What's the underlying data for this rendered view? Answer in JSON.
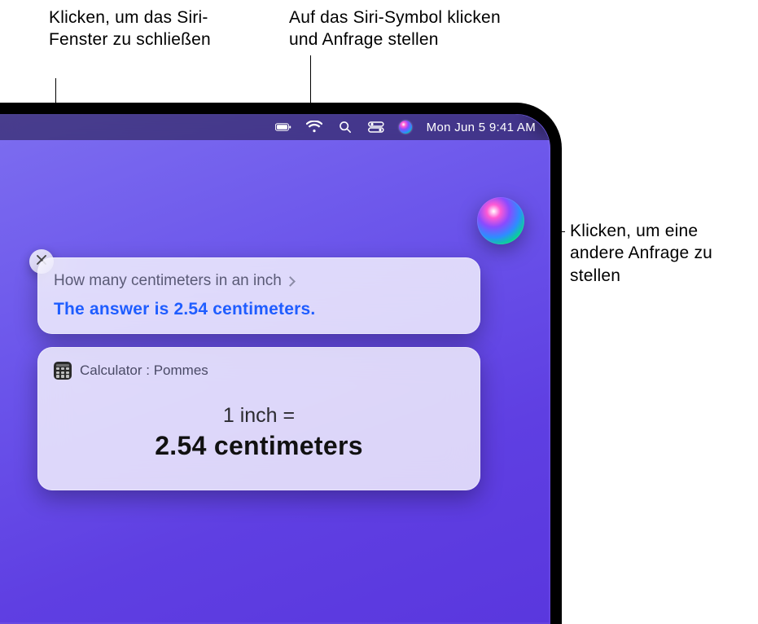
{
  "callouts": {
    "close": "Klicken, um das Siri-Fenster zu schließen",
    "siri_menu": "Auf das Siri-Symbol klicken und Anfrage stellen",
    "orb": "Klicken, um eine andere Anfrage zu stellen"
  },
  "menubar": {
    "datetime": "Mon Jun 5  9:41 AM",
    "icons": {
      "battery": "battery-icon",
      "wifi": "wifi-icon",
      "search": "search-icon",
      "control_center": "control-center-icon",
      "siri": "siri-icon"
    }
  },
  "siri": {
    "query": "How many centimeters in an inch",
    "answer": "The answer is 2.54 centimeters."
  },
  "calculator": {
    "title": "Calculator : Pommes",
    "from": "1 inch =",
    "to": "2.54 centimeters"
  }
}
